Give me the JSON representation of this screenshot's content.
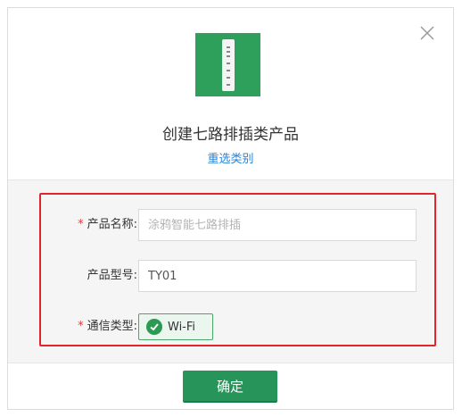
{
  "dialog": {
    "title": "创建七路排插类产品",
    "reselect_link": "重选类别",
    "close_icon": "close-icon",
    "product_image_icon": "power-strip-icon"
  },
  "form": {
    "required_mark": "*",
    "name": {
      "label": "产品名称:",
      "placeholder": "涂鸦智能七路排插",
      "value": ""
    },
    "model": {
      "label": "产品型号:",
      "value": "TY01"
    },
    "comm_type": {
      "label": "通信类型:",
      "option_label": "Wi-Fi",
      "selected": true,
      "icon": "check-circle-icon"
    }
  },
  "actions": {
    "confirm_label": "确定"
  },
  "colors": {
    "accent_green": "#27955a",
    "link_blue": "#2a83d6",
    "highlight_red": "#e0262b",
    "required_red": "#e4393c"
  }
}
